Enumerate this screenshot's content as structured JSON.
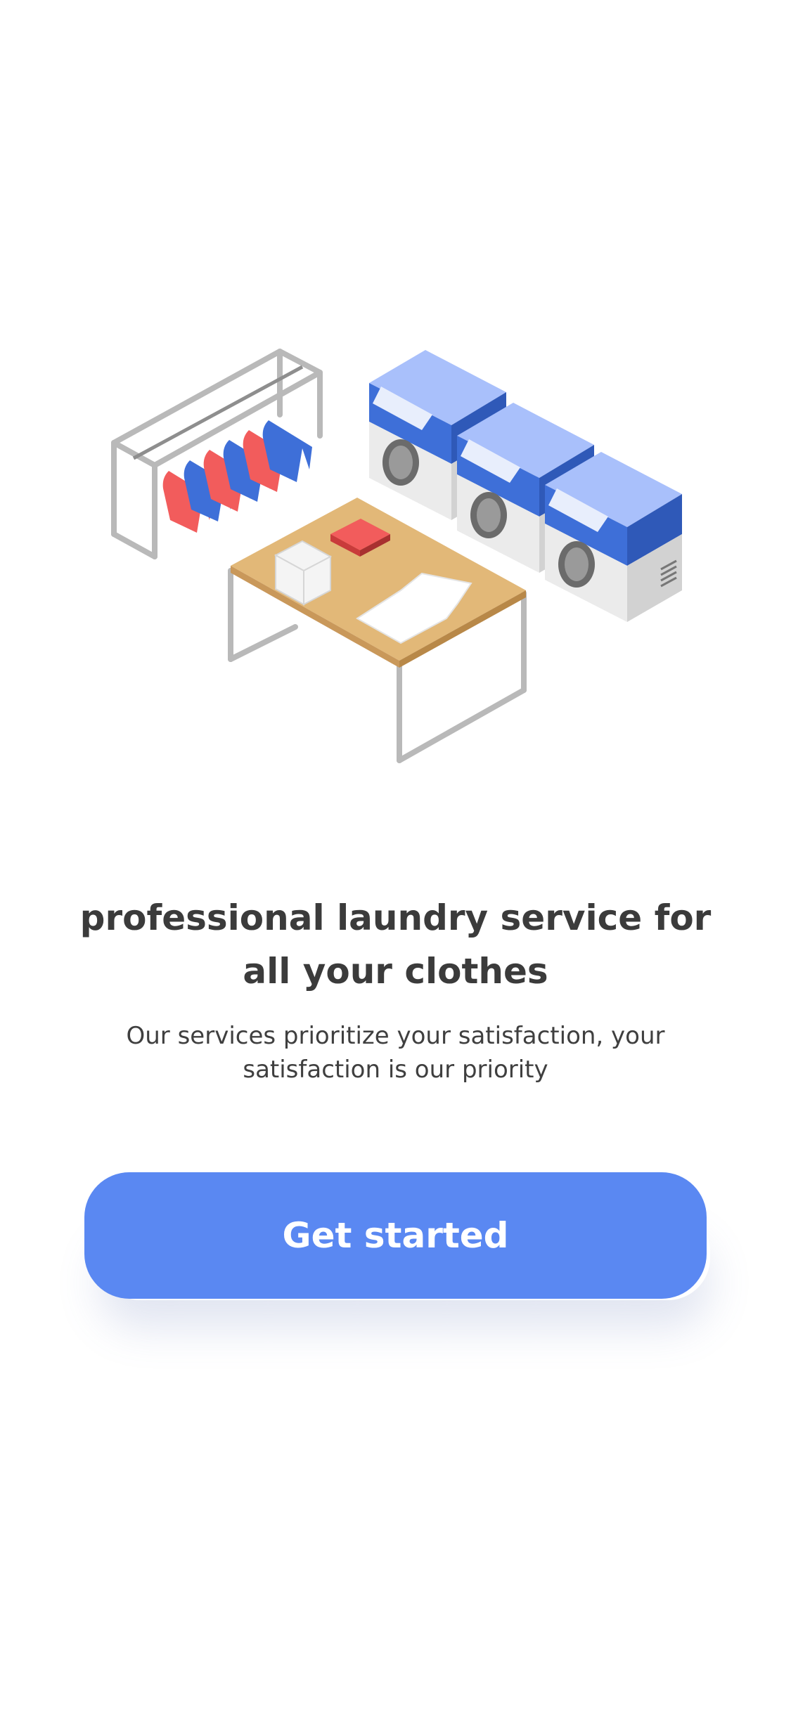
{
  "onboarding": {
    "title": "professional laundry service for all your clothes",
    "subtitle": "Our services prioritize your satisfaction, your satisfaction is our priority",
    "cta_label": "Get started"
  },
  "illustration": {
    "subject": "laundry-room",
    "items": [
      "clothes-rack",
      "washing-machine",
      "washing-machine",
      "washing-machine",
      "folding-table",
      "folded-towels",
      "shirt"
    ]
  },
  "colors": {
    "accent": "#5a88f2",
    "text": "#3b3b3b",
    "background": "#ffffff",
    "machine_blue": "#3e6fd8",
    "machine_blue_light": "#a9c0fb",
    "shirt_red": "#f25c5c",
    "table_wood": "#e2b878"
  }
}
